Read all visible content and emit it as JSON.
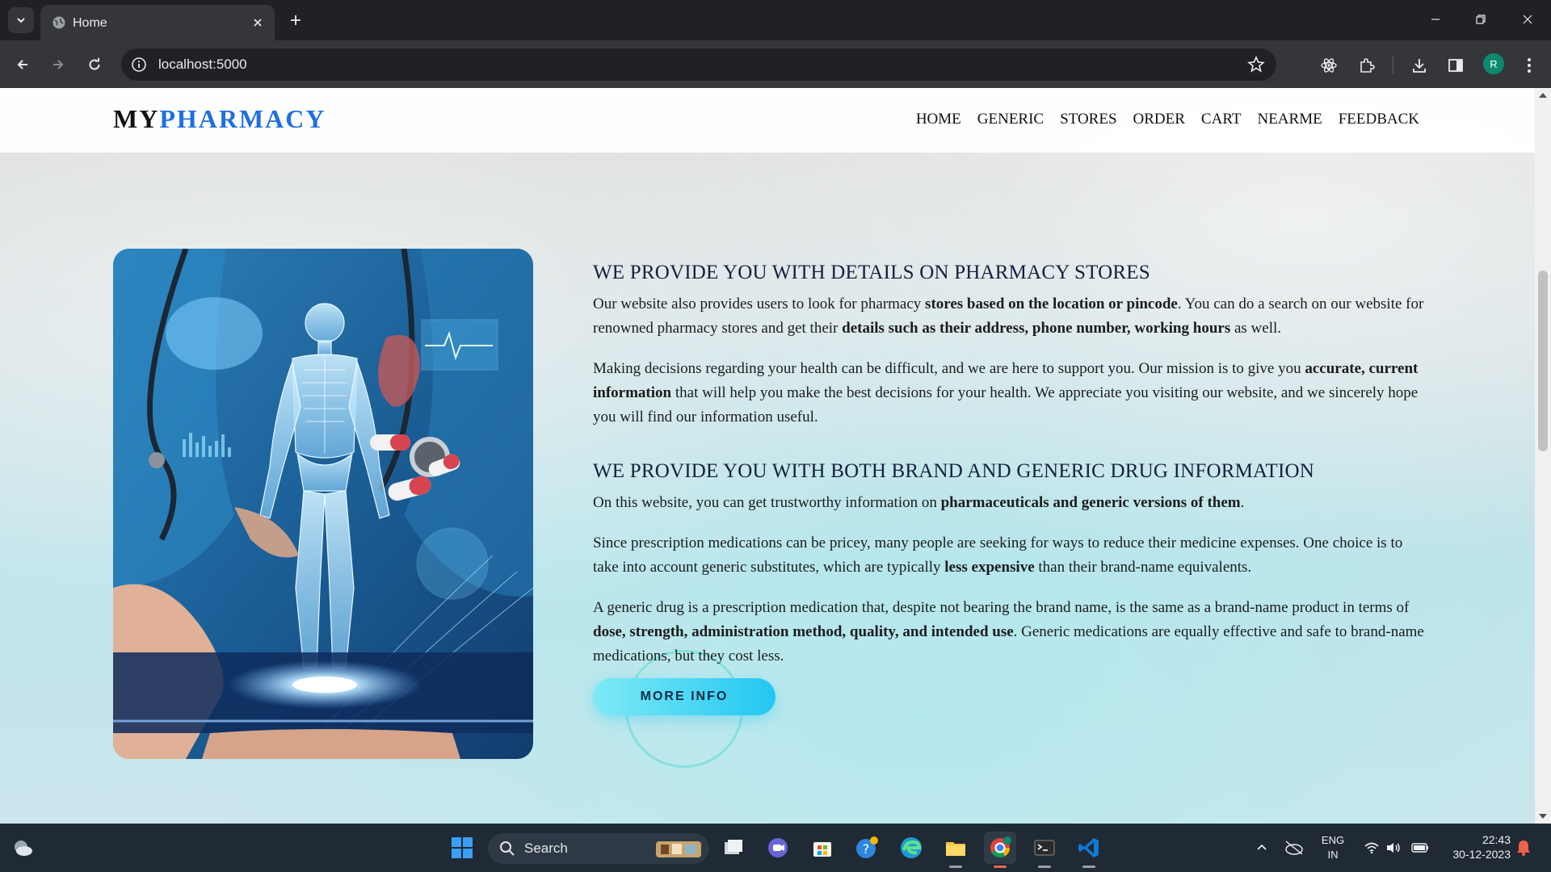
{
  "browser": {
    "tab_title": "Home",
    "url": "localhost:5000",
    "profile_initial": "R"
  },
  "site": {
    "logo_part1": "MY",
    "logo_part2": "PHARMACY",
    "nav": [
      "HOME",
      "GENERIC",
      "STORES",
      "ORDER",
      "CART",
      "NEARME",
      "FEEDBACK"
    ]
  },
  "section1": {
    "heading": "WE PROVIDE YOU WITH DETAILS ON PHARMACY STORES",
    "p1_a": "Our website also provides users to look for pharmacy ",
    "p1_b": "stores based on the location or pincode",
    "p1_c": ". You can do a search on our website for renowned pharmacy stores and get their ",
    "p1_d": "details such as their address, phone number, working hours",
    "p1_e": " as well.",
    "p2_a": "Making decisions regarding your health can be difficult, and we are here to support you. Our mission is to give you ",
    "p2_b": "accurate, current information",
    "p2_c": " that will help you make the best decisions for your health. We appreciate you visiting our website, and we sincerely hope you will find our information useful."
  },
  "section2": {
    "heading": "WE PROVIDE YOU WITH BOTH BRAND AND GENERIC DRUG INFORMATION",
    "p1_a": "On this website, you can get trustworthy information on ",
    "p1_b": "pharmaceuticals and generic versions of them",
    "p1_c": ".",
    "p2_a": "Since prescription medications can be pricey, many people are seeking for ways to reduce their medicine expenses. One choice is to take into account generic substitutes, which are typically ",
    "p2_b": "less expensive",
    "p2_c": " than their brand-name equivalents.",
    "p3_a": "A generic drug is a prescription medication that, despite not bearing the brand name, is the same as a brand-name product in terms of ",
    "p3_b": "dose, strength, administration method, quality, and intended use",
    "p3_c": ". Generic medications are equally effective and safe to brand-name medications, but they cost less.",
    "button": "MORE INFO"
  },
  "taskbar": {
    "search_label": "Search",
    "lang_line1": "ENG",
    "lang_line2": "IN",
    "time": "22:43",
    "date": "30-12-2023"
  },
  "colors": {
    "brand_blue": "#1f6fe0",
    "button_cyan": "#22c6f2"
  }
}
